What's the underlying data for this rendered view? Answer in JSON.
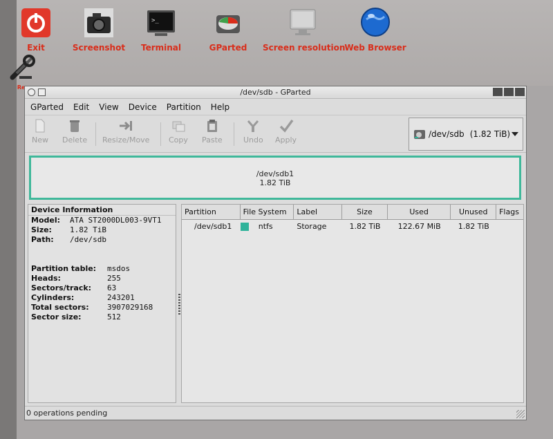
{
  "desktop": {
    "icons": [
      {
        "name": "exit-icon",
        "label": "Exit"
      },
      {
        "name": "screenshot-icon",
        "label": "Screenshot"
      },
      {
        "name": "terminal-icon",
        "label": "Terminal"
      },
      {
        "name": "gparted-icon",
        "label": "GParted"
      },
      {
        "name": "screen-resolution-icon",
        "label": "Screen resolution"
      },
      {
        "name": "web-browser-icon",
        "label": "Web Browser"
      },
      {
        "name": "tools-icon",
        "label": "Res"
      }
    ]
  },
  "window": {
    "title": "/dev/sdb - GParted",
    "menu": [
      "GParted",
      "Edit",
      "View",
      "Device",
      "Partition",
      "Help"
    ],
    "toolbar": [
      "New",
      "Delete",
      "Resize/Move",
      "Copy",
      "Paste",
      "Undo",
      "Apply"
    ],
    "device_selector": {
      "device": "/dev/sdb",
      "size": "(1.82 TiB)"
    },
    "disk_map": {
      "partition": "/dev/sdb1",
      "size": "1.82 TiB"
    },
    "device_info": {
      "header": "Device Information",
      "model_label": "Model:",
      "model": "ATA ST2000DL003-9VT1",
      "size_label": "Size:",
      "size": "1.82 TiB",
      "path_label": "Path:",
      "path": "/dev/sdb",
      "pt_label": "Partition table:",
      "pt": "msdos",
      "heads_label": "Heads:",
      "heads": "255",
      "sectors_track_label": "Sectors/track:",
      "sectors_track": "63",
      "cylinders_label": "Cylinders:",
      "cylinders": "243201",
      "total_sectors_label": "Total sectors:",
      "total_sectors": "3907029168",
      "sector_size_label": "Sector size:",
      "sector_size": "512"
    },
    "partition_table": {
      "columns": [
        "Partition",
        "File System",
        "Label",
        "Size",
        "Used",
        "Unused",
        "Flags"
      ],
      "rows": [
        {
          "partition": "/dev/sdb1",
          "fs": "ntfs",
          "label": "Storage",
          "size": "1.82 TiB",
          "used": "122.67 MiB",
          "unused": "1.82 TiB",
          "flags": ""
        }
      ]
    },
    "status": "0 operations pending",
    "colors": {
      "ntfs": "#2fb39a",
      "icon_label": "#d92d1a"
    }
  }
}
